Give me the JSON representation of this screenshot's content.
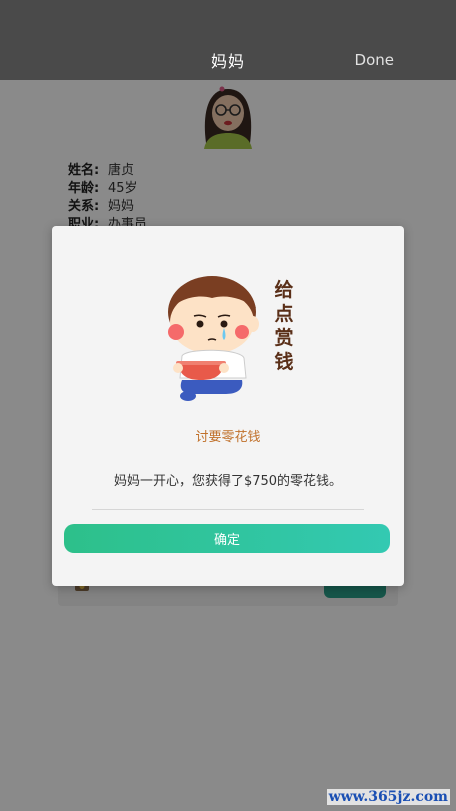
{
  "header": {
    "title": "妈妈",
    "done_label": "Done"
  },
  "profile": {
    "rows": [
      {
        "label": "姓名:",
        "value": "唐贞"
      },
      {
        "label": "年龄:",
        "value": "45岁"
      },
      {
        "label": "关系:",
        "value": "妈妈"
      },
      {
        "label": "职业:",
        "value": "办事员"
      }
    ]
  },
  "modal": {
    "illustration_caption": "给点赏钱",
    "subtitle": "讨要零花钱",
    "message": "妈妈一开心，您获得了$750的零花钱。",
    "confirm_label": "确定"
  },
  "watermark": "www.365jz.com",
  "colors": {
    "nav_bg": "#4a4a4a",
    "accent_start": "#2dc08a",
    "accent_end": "#33c9b2",
    "subtitle": "#c0702a"
  }
}
